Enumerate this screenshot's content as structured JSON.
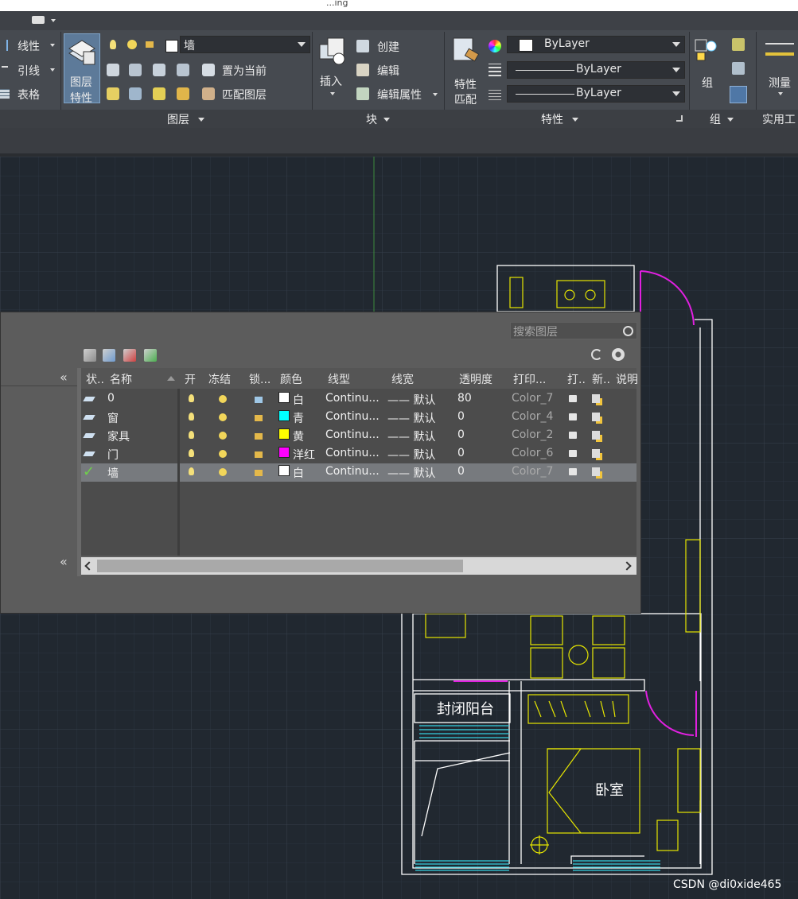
{
  "titlebar": {
    "text": "...ing"
  },
  "ribbon": {
    "left_col": {
      "linetype": "线性",
      "leader": "引线",
      "table": "表格"
    },
    "layer_panel": {
      "big_button": [
        "图层",
        "特性"
      ],
      "layer_combo_value": "墙",
      "set_current": "置为当前",
      "match_layer": "匹配图层",
      "title": "图层"
    },
    "block_panel": {
      "insert": "插入",
      "create": "创建",
      "edit": "编辑",
      "edit_attr": "编辑属性",
      "title": "块"
    },
    "properties_panel": {
      "match": [
        "特性",
        "匹配"
      ],
      "color_value": "ByLayer",
      "linetype_value": "ByLayer",
      "lineweight_value": "ByLayer",
      "title": "特性"
    },
    "group_panel": {
      "group": "组",
      "title": "组"
    },
    "utilities_panel": {
      "measure": "测量",
      "title": "实用工"
    }
  },
  "layer_dialog": {
    "search_placeholder": "搜索图层",
    "columns": [
      "状..",
      "名称",
      "开",
      "冻结",
      "锁...",
      "颜色",
      "线型",
      "线宽",
      "透明度",
      "打印...",
      "打..",
      "新..",
      "说明"
    ],
    "rows": [
      {
        "name": "0",
        "color_name": "白",
        "color": "#ffffff",
        "linetype": "Continu...",
        "lineweight": "—— 默认",
        "transparency": "80",
        "plot_style": "Color_7",
        "current": false,
        "selected": false
      },
      {
        "name": "窗",
        "color_name": "青",
        "color": "#00ffff",
        "linetype": "Continu...",
        "lineweight": "—— 默认",
        "transparency": "0",
        "plot_style": "Color_4",
        "current": false,
        "selected": false
      },
      {
        "name": "家具",
        "color_name": "黄",
        "color": "#ffff00",
        "linetype": "Continu...",
        "lineweight": "—— 默认",
        "transparency": "0",
        "plot_style": "Color_2",
        "current": false,
        "selected": false
      },
      {
        "name": "门",
        "color_name": "洋红",
        "color": "#ff00ff",
        "linetype": "Continu...",
        "lineweight": "—— 默认",
        "transparency": "0",
        "plot_style": "Color_6",
        "current": false,
        "selected": false
      },
      {
        "name": "墙",
        "color_name": "白",
        "color": "#ffffff",
        "linetype": "Continu...",
        "lineweight": "—— 默认",
        "transparency": "0",
        "plot_style": "Color_7",
        "current": true,
        "selected": true
      }
    ]
  },
  "drawing": {
    "balcony_label": "封闭阳台",
    "bedroom_label": "卧室"
  },
  "watermark": "CSDN @di0xide465"
}
